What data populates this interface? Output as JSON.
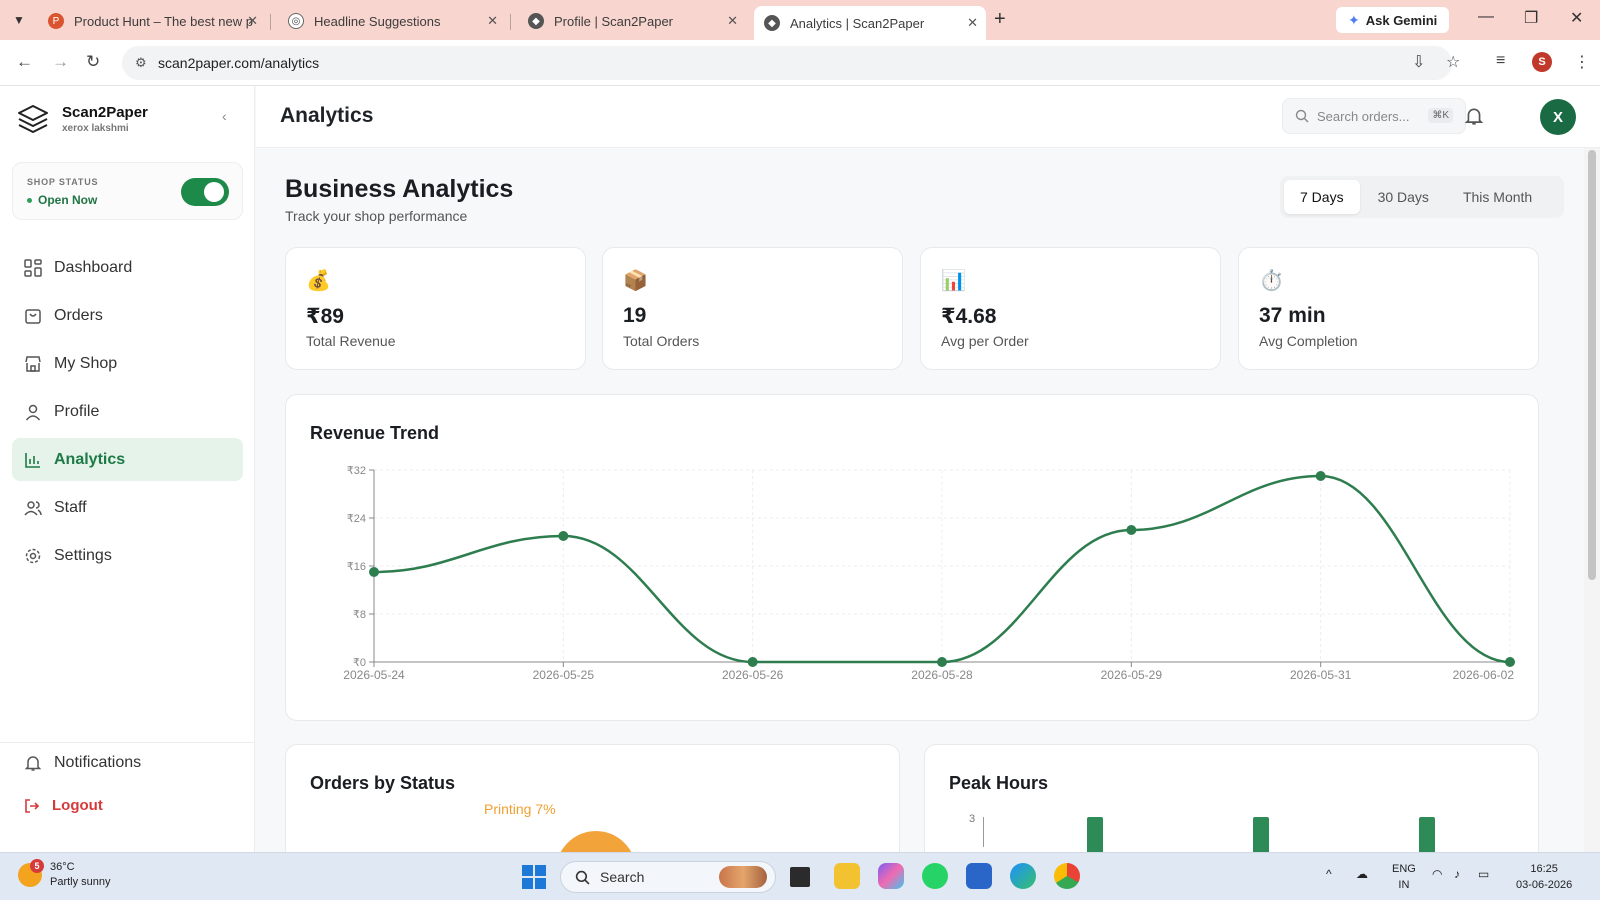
{
  "browser": {
    "tabs": [
      {
        "title": "Product Hunt – The best new p",
        "active": false
      },
      {
        "title": "Headline Suggestions",
        "active": false
      },
      {
        "title": "Profile | Scan2Paper",
        "active": false
      },
      {
        "title": "Analytics | Scan2Paper",
        "active": true
      }
    ],
    "ask_gemini": "Ask Gemini",
    "url": "scan2paper.com/analytics",
    "profile_initial": "S"
  },
  "sidebar": {
    "brand_name": "Scan2Paper",
    "brand_sub": "xerox lakshmi",
    "shop_status_label": "SHOP STATUS",
    "shop_status_value": "Open Now",
    "shop_open": true,
    "nav": [
      {
        "label": "Dashboard",
        "icon": "grid-icon",
        "active": false
      },
      {
        "label": "Orders",
        "icon": "bag-icon",
        "active": false
      },
      {
        "label": "My Shop",
        "icon": "store-icon",
        "active": false
      },
      {
        "label": "Profile",
        "icon": "user-icon",
        "active": false
      },
      {
        "label": "Analytics",
        "icon": "bar-chart-icon",
        "active": true
      },
      {
        "label": "Staff",
        "icon": "users-icon",
        "active": false
      },
      {
        "label": "Settings",
        "icon": "gear-icon",
        "active": false
      }
    ],
    "notifications": "Notifications",
    "logout": "Logout"
  },
  "topbar": {
    "title": "Analytics",
    "search_placeholder": "Search orders...",
    "search_shortcut": "⌘K",
    "avatar_initial": "X"
  },
  "header": {
    "title": "Business Analytics",
    "subtitle": "Track your shop performance",
    "ranges": [
      "7 Days",
      "30 Days",
      "This Month"
    ],
    "active_range": "7 Days"
  },
  "stats": [
    {
      "icon": "money-bag-icon",
      "emoji": "💰",
      "value": "₹89",
      "label": "Total Revenue"
    },
    {
      "icon": "package-icon",
      "emoji": "📦",
      "value": "19",
      "label": "Total Orders"
    },
    {
      "icon": "bar-chart-icon",
      "emoji": "📊",
      "value": "₹4.68",
      "label": "Avg per Order"
    },
    {
      "icon": "stopwatch-icon",
      "emoji": "⏱️",
      "value": "37 min",
      "label": "Avg Completion"
    }
  ],
  "chart_data": [
    {
      "type": "line",
      "title": "Revenue Trend",
      "x": [
        "2026-05-24",
        "2026-05-25",
        "2026-05-26",
        "2026-05-28",
        "2026-05-29",
        "2026-05-31",
        "2026-06-02"
      ],
      "values": [
        15,
        21,
        0,
        0,
        22,
        31,
        0
      ],
      "ylim": [
        0,
        32
      ],
      "yticks": [
        "₹0",
        "₹8",
        "₹16",
        "₹24",
        "₹32"
      ],
      "grid": true,
      "color": "#2e7d4f"
    },
    {
      "type": "pie",
      "title": "Orders by Status",
      "visible_label": "Printing 7%"
    },
    {
      "type": "bar",
      "title": "Peak Hours",
      "ytick_top": "3",
      "color": "#2e8b57"
    }
  ],
  "taskbar": {
    "weather_temp": "36°C",
    "weather_desc": "Partly sunny",
    "weather_badge": "5",
    "search": "Search",
    "lang_top": "ENG",
    "lang_bottom": "IN",
    "time": "16:25",
    "date": "03-06-2026"
  }
}
